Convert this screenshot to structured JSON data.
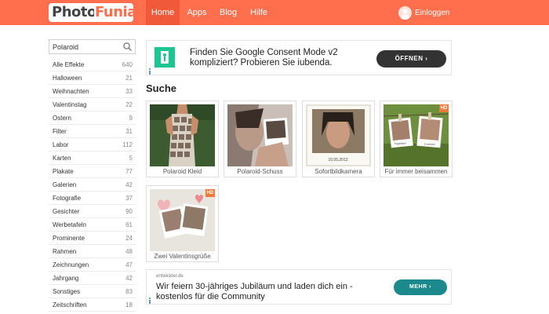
{
  "header": {
    "logo": {
      "part1": "Photo",
      "part2": "Funia"
    },
    "nav": [
      {
        "label": "Home",
        "active": true
      },
      {
        "label": "Apps",
        "active": false
      },
      {
        "label": "Blog",
        "active": false
      },
      {
        "label": "Hilfe",
        "active": false
      }
    ],
    "login_label": "Einloggen",
    "colors": {
      "bar": "#ff6f4e",
      "active": "#f05a3a"
    }
  },
  "search": {
    "value": "Polaroid",
    "icon": "search-icon"
  },
  "sidebar": {
    "categories": [
      {
        "name": "Alle Effekte",
        "count": "640"
      },
      {
        "name": "Halloween",
        "count": "21"
      },
      {
        "name": "Weihnachten",
        "count": "33"
      },
      {
        "name": "Valentinstag",
        "count": "22"
      },
      {
        "name": "Ostern",
        "count": "9"
      },
      {
        "name": "Filter",
        "count": "31"
      },
      {
        "name": "Labor",
        "count": "112"
      },
      {
        "name": "Karten",
        "count": "5"
      },
      {
        "name": "Plakate",
        "count": "77"
      },
      {
        "name": "Galerien",
        "count": "42"
      },
      {
        "name": "Fotografie",
        "count": "37"
      },
      {
        "name": "Gesichter",
        "count": "90"
      },
      {
        "name": "Werbetafeln",
        "count": "61"
      },
      {
        "name": "Prominente",
        "count": "24"
      },
      {
        "name": "Rahmen",
        "count": "48"
      },
      {
        "name": "Zeichnungen",
        "count": "47"
      },
      {
        "name": "Jahrgang",
        "count": "42"
      },
      {
        "name": "Sonstiges",
        "count": "83"
      },
      {
        "name": "Zeitschriften",
        "count": "18"
      }
    ]
  },
  "ad_top": {
    "text": "Finden Sie Google Consent Mode v2 kompliziert? Probieren Sie iubenda.",
    "cta": "ÖFFNEN",
    "accent": "#1cc691"
  },
  "main": {
    "title": "Suche",
    "results": [
      {
        "caption": "Polaroid Kleid",
        "hd": false
      },
      {
        "caption": "Polaroid-Schuss",
        "hd": false
      },
      {
        "caption": "Sofortbildkamera",
        "hd": false,
        "photo_text": "10.05.2012"
      },
      {
        "caption": "Für immer beisammen",
        "hd": true,
        "hd_label": "HD",
        "photo_text_left": "Together",
        "photo_text_right": "Forever"
      },
      {
        "caption": "Zwei Valentinsgrüße",
        "hd": true,
        "hd_label": "HD"
      }
    ]
  },
  "ad_bottom": {
    "brand": "entwickler.de",
    "text": "Wir feiern 30-jähriges Jubiläum und laden dich ein - kostenlos für die Community",
    "cta": "MEHR",
    "accent": "#1c8a8c"
  }
}
